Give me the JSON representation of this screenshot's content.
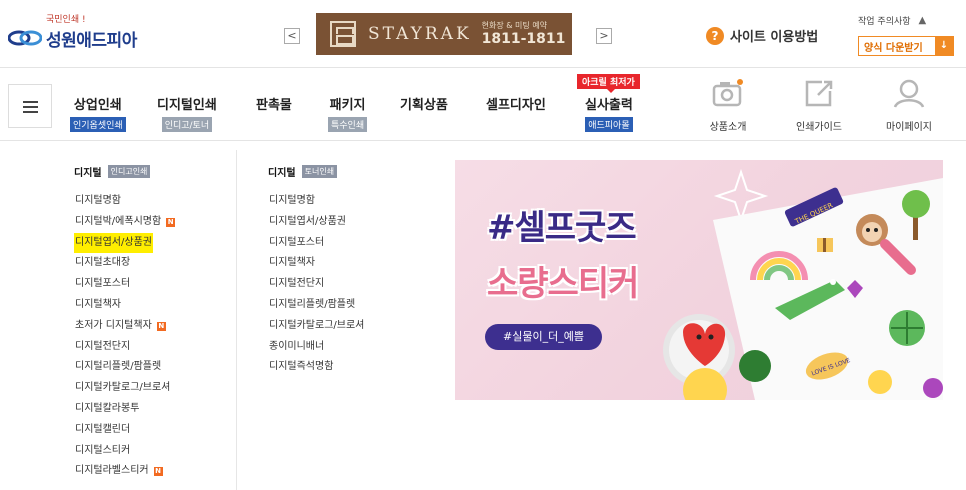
{
  "header": {
    "tagline": "국민인쇄 !",
    "logo_text": "성원애드피아",
    "ad": {
      "brand": "STAYRAK",
      "sub": "현화장 & 미팅 예약",
      "phone": "1811-1811"
    },
    "arrow_prev": "<",
    "arrow_next": ">",
    "help_icon": "?",
    "help_label": "사이트 이용방법",
    "notice_label": "작업 주의사항",
    "notice_icon": "▲",
    "download_label": "양식 다운받기",
    "download_icon": "↓"
  },
  "nav": {
    "hot_badge": "아크릴 최저가",
    "items": [
      {
        "label": "상업인쇄",
        "sub": "인기옵셋인쇄"
      },
      {
        "label": "디지털인쇄",
        "sub": "인디고/토너"
      },
      {
        "label": "판촉물",
        "sub": ""
      },
      {
        "label": "패키지",
        "sub": "특수인쇄"
      },
      {
        "label": "기획상품",
        "sub": ""
      },
      {
        "label": "셀프디자인",
        "sub": ""
      },
      {
        "label": "실사출력",
        "sub": "애드피아몰"
      }
    ],
    "icon_items": [
      {
        "label": "상품소개",
        "icon": "camera-icon"
      },
      {
        "label": "인쇄가이드",
        "icon": "external-link-icon"
      },
      {
        "label": "마이페이지",
        "icon": "user-icon"
      }
    ]
  },
  "dropdown": {
    "col1": {
      "heading": "디지털",
      "tag": "인디고인쇄",
      "items": [
        {
          "label": "디지털명함",
          "new": false,
          "highlight": false
        },
        {
          "label": "디지털박/에폭시명함",
          "new": true,
          "highlight": false
        },
        {
          "label": "디지털엽서/상품권",
          "new": false,
          "highlight": true
        },
        {
          "label": "디지털초대장",
          "new": false,
          "highlight": false
        },
        {
          "label": "디지털포스터",
          "new": false,
          "highlight": false
        },
        {
          "label": "디지털책자",
          "new": false,
          "highlight": false
        },
        {
          "label": "초저가 디지털책자",
          "new": true,
          "highlight": false
        },
        {
          "label": "디지털전단지",
          "new": false,
          "highlight": false
        },
        {
          "label": "디지털리플렛/팜플렛",
          "new": false,
          "highlight": false
        },
        {
          "label": "디지털카탈로그/브로셔",
          "new": false,
          "highlight": false
        },
        {
          "label": "디지털칼라봉투",
          "new": false,
          "highlight": false
        },
        {
          "label": "디지털캘린더",
          "new": false,
          "highlight": false
        },
        {
          "label": "디지털스티커",
          "new": false,
          "highlight": false
        },
        {
          "label": "디지털라벨스티커",
          "new": true,
          "highlight": false
        }
      ]
    },
    "col2": {
      "heading": "디지털",
      "tag": "토너인쇄",
      "items": [
        {
          "label": "디지털명함"
        },
        {
          "label": "디지털엽서/상품권"
        },
        {
          "label": "디지털포스터"
        },
        {
          "label": "디지털책자"
        },
        {
          "label": "디지털전단지"
        },
        {
          "label": "디지털리플렛/팜플렛"
        },
        {
          "label": "디지털카탈로그/브로셔"
        },
        {
          "label": "종이미니배너"
        },
        {
          "label": "디지털즉석명함"
        }
      ]
    },
    "new_badge": "N",
    "promo": {
      "line1": "#셀프굿즈",
      "line2": "소량스티커",
      "pill": "#실물이_더_예쁨",
      "sticker_text_1": "THE QUEER",
      "sticker_text_2": "LOVE IS LOVE"
    }
  },
  "colors": {
    "brand_blue": "#1f3d8c",
    "accent_orange": "#f08a24",
    "hot_red": "#e8262c",
    "highlight": "#ffee00"
  }
}
